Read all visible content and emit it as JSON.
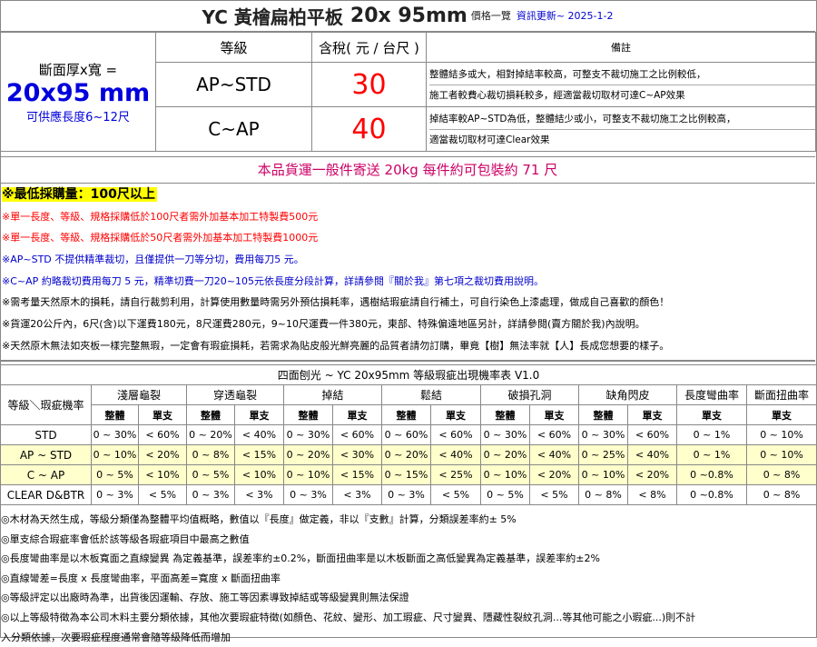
{
  "title": {
    "main": "YC 黃檜扁柏平板",
    "size": "20x 95mm",
    "subtitle": "價格一覽",
    "update_label": "資訊更新~ 2025-1-2"
  },
  "price_table": {
    "left": {
      "label": "斷面厚x寬 =",
      "size": "20x95 mm",
      "length": "可供應長度6~12尺"
    },
    "headers": {
      "grade": "等級",
      "price": "含稅( 元 / 台尺 )",
      "note": "備註"
    },
    "rows": [
      {
        "grade": "AP~STD",
        "price": "30",
        "notes": [
          "整體結多或大，相對掉結率較高，可整支不裁切施工之比例較低，",
          "施工者較費心裁切損耗較多，經適當裁切取材可達C~AP效果"
        ]
      },
      {
        "grade": "C~AP",
        "price": "40",
        "notes": [
          "掉結率較AP~STD為低，整體結少或小，可整支不裁切施工之比例較高，",
          "適當裁切取材可達Clear效果"
        ]
      }
    ]
  },
  "shipping": "本品貨運一般件寄送 20kg 每件約可包裝約 71 尺",
  "notes": {
    "min_purchase": "※最低採購量：100尺以上",
    "n1": "※單一長度、等級、規格採購低於100尺者需外加基本加工特製費500元",
    "n2": "※單一長度、等級、規格採購低於50尺者需外加基本加工特製費1000元",
    "n3": "※AP~STD 不提供精準裁切，且僅提供一刀等分切，費用每刀5 元。",
    "n4": "※C~AP 約略裁切費用每刀 5 元，精準切費一刀20~105元依長度分段計算，詳請參閱『關於我』第七項之裁切費用說明。",
    "n5": "※需考量天然原木的損耗，請自行裁剪利用，計算使用數量時需另外預估損耗率，遇樹結瑕疵請自行補土，可自行染色上漆處理，做成自己喜歡的顏色！",
    "n6": "※貨運20公斤內，6尺(含)以下運費180元，8尺運費280元，9~10尺運費一件380元，東部、特殊偏遠地區另計，詳請參閱(賣方關於我)內說明。",
    "n7": "※天然原木無法如夾板一樣完整無瑕，一定會有瑕疵損耗，若需求為貼皮般光鮮亮麗的品質者請勿訂購，畢竟【樹】無法率就【人】長成您想要的樣子。"
  },
  "defect_table": {
    "title": "四面刨光 ~ YC 20x95mm 等級瑕疵出現機率表 V1.0",
    "corner": "等級＼瑕疵機率",
    "groups": [
      "淺層龜裂",
      "穿透龜裂",
      "掉結",
      "鬆結",
      "破損孔洞",
      "缺角閃皮",
      "長度彎曲率",
      "斷面扭曲率"
    ],
    "sub_whole": "整體",
    "sub_single": "單支",
    "rows": [
      {
        "grade": "STD",
        "cells": [
          "0 ~ 30%",
          "< 60%",
          "0 ~ 20%",
          "< 40%",
          "0 ~ 30%",
          "< 60%",
          "0 ~ 60%",
          "< 60%",
          "0 ~ 30%",
          "< 60%",
          "0 ~ 30%",
          "< 60%",
          "0 ~ 1%",
          "0 ~ 10%"
        ]
      },
      {
        "grade": "AP ~ STD",
        "cells": [
          "0 ~ 10%",
          "< 20%",
          "0 ~ 8%",
          "< 15%",
          "0 ~ 20%",
          "< 30%",
          "0 ~ 20%",
          "< 40%",
          "0 ~ 20%",
          "< 40%",
          "0 ~ 25%",
          "< 40%",
          "0 ~ 1%",
          "0 ~ 10%"
        ]
      },
      {
        "grade": "C ~ AP",
        "cells": [
          "0 ~ 5%",
          "< 10%",
          "0 ~ 5%",
          "< 10%",
          "0 ~ 10%",
          "< 15%",
          "0 ~ 15%",
          "< 25%",
          "0 ~ 10%",
          "< 20%",
          "0 ~ 10%",
          "< 20%",
          "0 ~0.8%",
          "0 ~ 8%"
        ]
      },
      {
        "grade": "CLEAR D&BTR",
        "cells": [
          "0 ~ 3%",
          "< 5%",
          "0 ~ 3%",
          "< 3%",
          "0 ~ 3%",
          "< 3%",
          "0 ~ 3%",
          "< 5%",
          "0 ~ 5%",
          "< 5%",
          "0 ~ 8%",
          "< 8%",
          "0 ~0.8%",
          "0 ~ 8%"
        ]
      }
    ]
  },
  "footnotes": [
    "◎木材為天然生成，等級分類僅為整體平均值概略，數值以『長度』做定義，非以『支數』計算，分類誤差率約± 5%",
    "◎單支綜合瑕疵率會低於該等級各瑕疵項目中最高之數值",
    "◎長度彎曲率是以木板寬面之直線變異 為定義基準，誤差率約±0.2%，斷面扭曲率是以木板斷面之高低變異為定義基準，誤差率約±2%",
    "◎直線彎差=長度 x 長度彎曲率，平面高差=寬度 x 斷面扭曲率",
    "◎等級評定以出廠時為準，出貨後因運輸、存放、施工等因素導致掉結或等級變異則無法保證",
    "◎以上等級特徵為本公司木料主要分類依據，其他次要瑕疵特徵(如顏色、花紋、變形、加工瑕疵、尺寸變異、隱藏性裂紋孔洞...等其他可能之小瑕疵...)則不計",
    "入分類依據，次要瑕疵程度通常會隨等級降低而增加"
  ]
}
